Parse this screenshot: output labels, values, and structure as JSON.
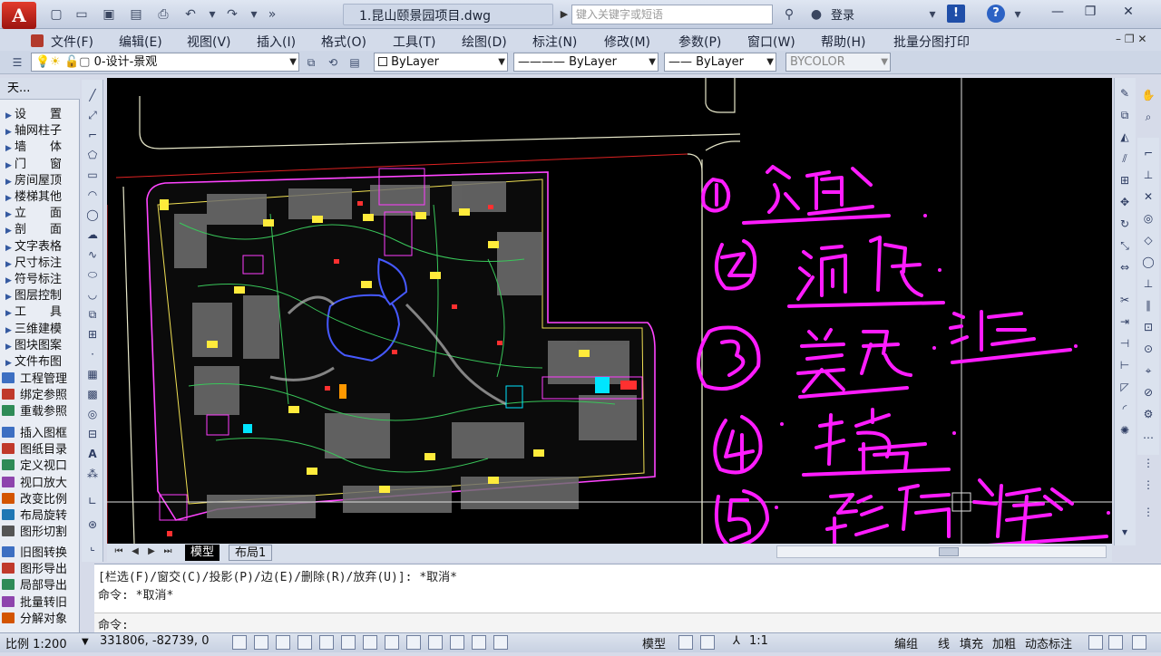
{
  "app": {
    "logo_letter": "A",
    "window_title": "1.昆山颐景园项目.dwg",
    "search_placeholder": "键入关键字或短语",
    "login": "登录"
  },
  "menu": [
    "文件(F)",
    "编辑(E)",
    "视图(V)",
    "插入(I)",
    "格式(O)",
    "工具(T)",
    "绘图(D)",
    "标注(N)",
    "修改(M)",
    "参数(P)",
    "窗口(W)",
    "帮助(H)",
    "批量分图打印"
  ],
  "layer_toolbar": {
    "layer": "0-设计-景观",
    "color": "ByLayer",
    "linetype": "ByLayer",
    "lineweight": "ByLayer",
    "plotstyle": "BYCOLOR"
  },
  "palette": {
    "title": "天...",
    "group1": [
      "设　　置",
      "轴网柱子",
      "墙　　体",
      "门　　窗",
      "房间屋顶",
      "楼梯其他",
      "立　　面",
      "剖　　面",
      "文字表格",
      "尺寸标注",
      "符号标注",
      "图层控制",
      "工　　具",
      "三维建模",
      "图块图案",
      "文件布图"
    ],
    "group2": [
      "工程管理",
      "绑定参照",
      "重载参照"
    ],
    "group3": [
      "插入图框",
      "图纸目录",
      "定义视口",
      "视口放大",
      "改变比例",
      "布局旋转",
      "图形切割"
    ],
    "group4": [
      "旧图转换",
      "图形导出",
      "局部导出",
      "批量转旧",
      "分解对象"
    ]
  },
  "tabs": {
    "model": "模型",
    "layout1": "布局1"
  },
  "command": {
    "history1": "[栏选(F)/窗交(C)/投影(P)/边(E)/删除(R)/放弃(U)]:  *取消*",
    "history2": "命令: *取消*",
    "prompt": "命令:"
  },
  "statusbar": {
    "scale": "比例 1:200",
    "coords": "331806, -82739, 0",
    "model": "模型",
    "annotation_scale": "1:1",
    "buttons": [
      "编组",
      "线",
      "填充",
      "加粗",
      "动态标注"
    ]
  },
  "handwriting": [
    "交通",
    "消防",
    "美观",
    "经理",
    "接高",
    "建筑",
    "结构",
    "绿地"
  ],
  "colors": {
    "ink": "#ff1cff",
    "canvas": "#000000",
    "menu_bg": "#d3dbea"
  }
}
